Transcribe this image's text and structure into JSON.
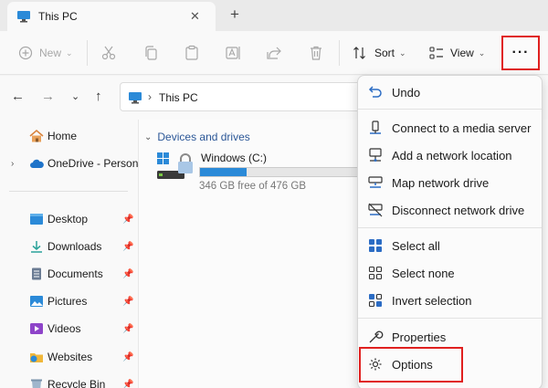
{
  "window": {
    "tab_title": "This PC",
    "tab_close": "✕",
    "new_tab": "+"
  },
  "toolbar": {
    "new_label": "New",
    "sort_label": "Sort",
    "view_label": "View",
    "more_label": "···",
    "icons": [
      "cut-icon",
      "copy-icon",
      "paste-icon",
      "rename-icon",
      "share-icon",
      "delete-icon"
    ]
  },
  "address": {
    "location": "This PC"
  },
  "sidebar": {
    "items": [
      {
        "label": "Home"
      },
      {
        "label": "OneDrive - Persona"
      },
      {
        "label": "Desktop"
      },
      {
        "label": "Downloads"
      },
      {
        "label": "Documents"
      },
      {
        "label": "Pictures"
      },
      {
        "label": "Videos"
      },
      {
        "label": "Websites"
      },
      {
        "label": "Recycle Bin"
      }
    ]
  },
  "content": {
    "section": "Devices and drives",
    "drive": {
      "name": "Windows (C:)",
      "free_text": "346 GB free of 476 GB",
      "used_fraction": 0.273
    }
  },
  "menu": {
    "items": [
      {
        "label": "Undo",
        "icon": "undo-icon"
      },
      {
        "label": "Connect to a media server",
        "icon": "media-server-icon"
      },
      {
        "label": "Add a network location",
        "icon": "network-location-icon"
      },
      {
        "label": "Map network drive",
        "icon": "map-drive-icon"
      },
      {
        "label": "Disconnect network drive",
        "icon": "disconnect-drive-icon"
      },
      {
        "label": "Select all",
        "icon": "select-all-icon"
      },
      {
        "label": "Select none",
        "icon": "select-none-icon"
      },
      {
        "label": "Invert selection",
        "icon": "invert-selection-icon"
      },
      {
        "label": "Properties",
        "icon": "properties-icon"
      },
      {
        "label": "Options",
        "icon": "options-icon"
      }
    ]
  },
  "colors": {
    "highlight": "#e0201f",
    "accent": "#2b8ad8",
    "folder_blue": "#2b6cc4"
  }
}
